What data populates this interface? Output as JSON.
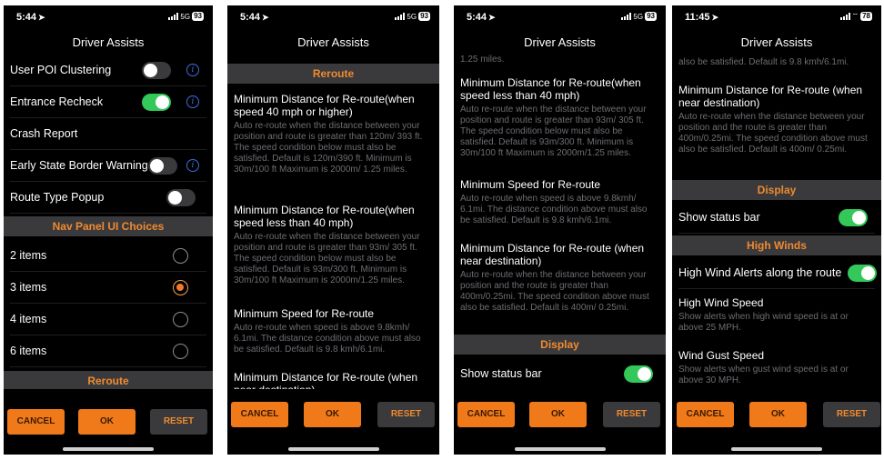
{
  "screens": [
    {
      "status_time": "5:44",
      "status_network": "5G",
      "status_battery": "93",
      "title": "Driver Assists",
      "rows": [
        {
          "label": "User POI Clustering",
          "toggle": "off",
          "info": true
        },
        {
          "label": "Entrance Recheck",
          "toggle": "on",
          "info": true
        },
        {
          "label": "Crash Report"
        },
        {
          "label": "Early State Border Warning",
          "toggle": "off",
          "info": true
        },
        {
          "label": "Route Type Popup",
          "toggle": "off"
        }
      ],
      "section_nav": "Nav Panel UI Choices",
      "radio_items": [
        {
          "label": "2 items",
          "selected": false
        },
        {
          "label": "3 items",
          "selected": true
        },
        {
          "label": "4 items",
          "selected": false
        },
        {
          "label": "6 items",
          "selected": false
        }
      ],
      "section_reroute": "Reroute"
    },
    {
      "status_time": "5:44",
      "status_network": "5G",
      "status_battery": "93",
      "title": "Driver Assists",
      "section_reroute": "Reroute",
      "blocks": [
        {
          "heading": "Minimum Distance for Re-route(when speed 40 mph or higher)",
          "desc": "Auto re-route when the distance between your position and route is greater than 120m/ 393 ft. The speed condition below must also be satisfied. Default is 120m/390 ft. Minimum is 30m/100 ft Maximum is 2000m/ 1.25 miles."
        },
        {
          "heading": "Minimum Distance for Re-route(when speed less than 40 mph)",
          "desc": "Auto re-route when the distance between your position and route is greater than 93m/ 305 ft. The speed condition below must also be satisfied. Default is 93m/300 ft. Minimum is 30m/100 ft Maximum is 2000m/1.25 miles."
        },
        {
          "heading": "Minimum Speed for Re-route",
          "desc": "Auto re-route when speed is above 9.8kmh/ 6.1mi. The distance condition above must also be satisfied. Default is 9.8 kmh/6.1mi."
        },
        {
          "heading": "Minimum Distance for Re-route (when near destination)",
          "desc": ""
        }
      ]
    },
    {
      "status_time": "5:44",
      "status_network": "5G",
      "status_battery": "93",
      "title": "Driver Assists",
      "top_fragment": "1.25 miles.",
      "blocks": [
        {
          "heading": "Minimum Distance for Re-route(when speed less than 40 mph)",
          "desc": "Auto re-route when the distance between your position and route is greater than 93m/ 305 ft. The speed condition below must also be satisfied. Default is 93m/300 ft. Minimum is 30m/100 ft Maximum is 2000m/1.25 miles."
        },
        {
          "heading": "Minimum Speed for Re-route",
          "desc": "Auto re-route when speed is above 9.8kmh/ 6.1mi. The distance condition above must also be satisfied. Default is 9.8 kmh/6.1mi."
        },
        {
          "heading": "Minimum Distance for Re-route (when near destination)",
          "desc": "Auto re-route when the distance between your position and the route is greater than 400m/0.25mi. The speed condition above must also be satisfied. Default is 400m/ 0.25mi."
        }
      ],
      "section_display": "Display",
      "show_status_bar": {
        "label": "Show status bar",
        "toggle": "on"
      }
    },
    {
      "status_time": "11:45",
      "status_battery": "78",
      "title": "Driver Assists",
      "top_fragment": "also be satisfied. Default is 9.8 kmh/6.1mi.",
      "blocks": [
        {
          "heading": "Minimum Distance for Re-route (when near destination)",
          "desc": "Auto re-route when the distance between your position and the route is greater than 400m/0.25mi. The speed condition above must also be satisfied. Default is 400m/ 0.25mi."
        }
      ],
      "section_display": "Display",
      "show_status_bar": {
        "label": "Show status bar",
        "toggle": "on"
      },
      "section_winds": "High Winds",
      "high_wind_alerts": {
        "label": "High Wind Alerts along the route",
        "toggle": "on"
      },
      "wind_blocks": [
        {
          "heading": "High Wind Speed",
          "desc": "Show alerts when high wind speed is at or above 25 MPH."
        },
        {
          "heading": "Wind Gust Speed",
          "desc": "Show alerts when gust wind speed is at or above 30 MPH."
        }
      ]
    }
  ],
  "buttons": {
    "cancel": "CANCEL",
    "ok": "OK",
    "reset": "RESET"
  },
  "colors": {
    "accent": "#f07a1a",
    "toggle_on": "#34c759",
    "section_bg": "#3a3a3c",
    "info": "#3b6fe0"
  }
}
